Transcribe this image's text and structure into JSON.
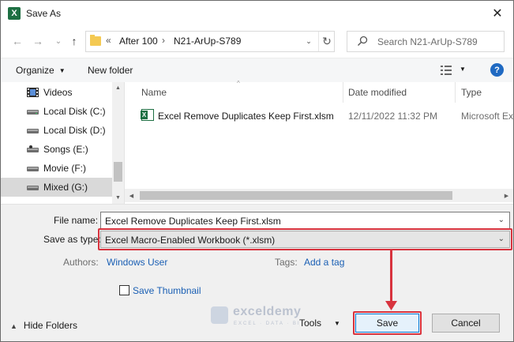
{
  "window": {
    "title": "Save As",
    "app_icon": "excel-icon",
    "close_glyph": "✕"
  },
  "nav": {
    "back_glyph": "←",
    "forward_glyph": "→",
    "history_glyph": "⌄",
    "up_glyph": "↑",
    "address": {
      "overflow": "«",
      "crumbs": [
        "After 100",
        "N21-ArUp-S789"
      ],
      "sep": "›",
      "dropdown_glyph": "⌄",
      "refresh_glyph": "↻"
    },
    "search": {
      "placeholder": "Search N21-ArUp-S789"
    }
  },
  "toolbar": {
    "organize": "Organize",
    "new_folder": "New folder",
    "caret": "▼",
    "help": "?"
  },
  "sidebar": {
    "items": [
      {
        "label": "Videos",
        "icon": "film-icon"
      },
      {
        "label": "Local Disk (C:)",
        "icon": "drive-icon"
      },
      {
        "label": "Local Disk (D:)",
        "icon": "drive-icon"
      },
      {
        "label": "Songs (E:)",
        "icon": "drive-icon"
      },
      {
        "label": "Movie (F:)",
        "icon": "drive-icon"
      },
      {
        "label": "Mixed (G:)",
        "icon": "drive-icon",
        "selected": true
      }
    ],
    "scroll_up": "▲",
    "scroll_down": "▼"
  },
  "filelist": {
    "columns": [
      "Name",
      "Date modified",
      "Type"
    ],
    "sort_glyph": "^",
    "rows": [
      {
        "name": "Excel Remove Duplicates Keep First.xlsm",
        "date": "12/11/2022 11:32 PM",
        "type": "Microsoft Ex"
      }
    ],
    "scroll_left": "◀",
    "scroll_right": "▶"
  },
  "form": {
    "filename_label": "File name:",
    "filename_value": "Excel Remove Duplicates Keep First.xlsm",
    "type_label": "Save as type:",
    "type_value": "Excel Macro-Enabled Workbook (*.xlsm)",
    "dropdown_glyph": "⌄",
    "authors_label": "Authors:",
    "authors_value": "Windows User",
    "tags_label": "Tags:",
    "tags_value": "Add a tag",
    "thumbnail_label": "Save Thumbnail",
    "hide_folders": "Hide Folders",
    "hide_caret": "▲",
    "tools": "Tools",
    "tools_caret": "▼",
    "save": "Save",
    "cancel": "Cancel"
  },
  "watermark": {
    "name": "exceldemy",
    "tagline": "EXCEL · DATA · BI"
  },
  "colors": {
    "highlight": "#d8333e",
    "accent": "#0078d7",
    "link": "#1a5fb4",
    "excel_green": "#1d6f42"
  }
}
